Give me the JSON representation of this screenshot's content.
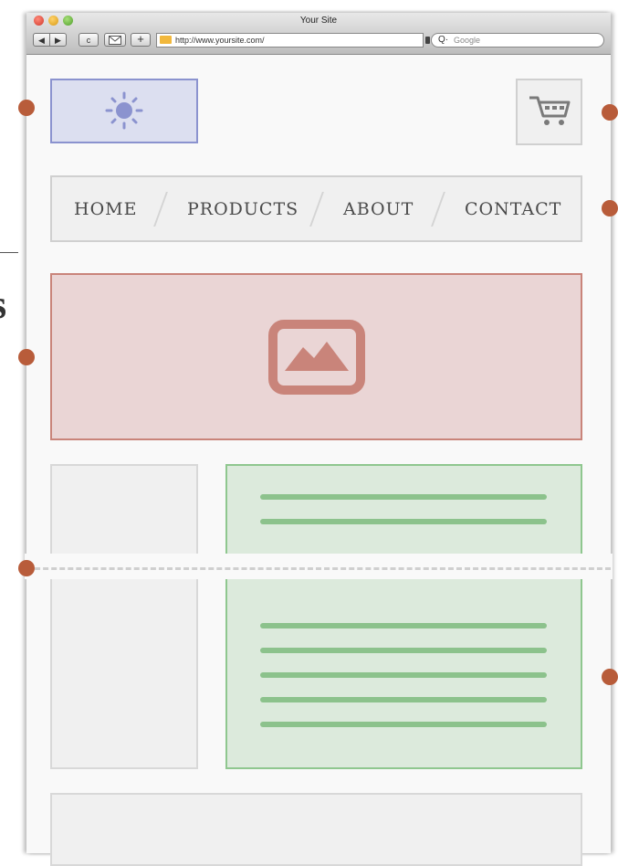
{
  "window": {
    "title": "Your Site",
    "address": "http://www.yoursite.com/",
    "search_placeholder": "Google",
    "add_button": "+",
    "back_button": "◀",
    "forward_button": "▶",
    "reload_button": "c"
  },
  "header": {
    "logo_icon": "sun-icon",
    "cart_icon": "cart-icon"
  },
  "nav": {
    "items": [
      "HOME",
      "PRODUCTS",
      "ABOUT",
      "CONTACT"
    ],
    "separator": "/"
  },
  "hero": {
    "icon": "image-icon"
  },
  "side": {
    "glyph": "s"
  },
  "colors": {
    "logo_bg": "#dcdff0",
    "logo_border": "#8b93cf",
    "hero_bg": "#ead5d5",
    "hero_border": "#c9847a",
    "content_bg": "#dceadc",
    "content_border": "#8fc78f",
    "dot": "#b85c3a"
  }
}
